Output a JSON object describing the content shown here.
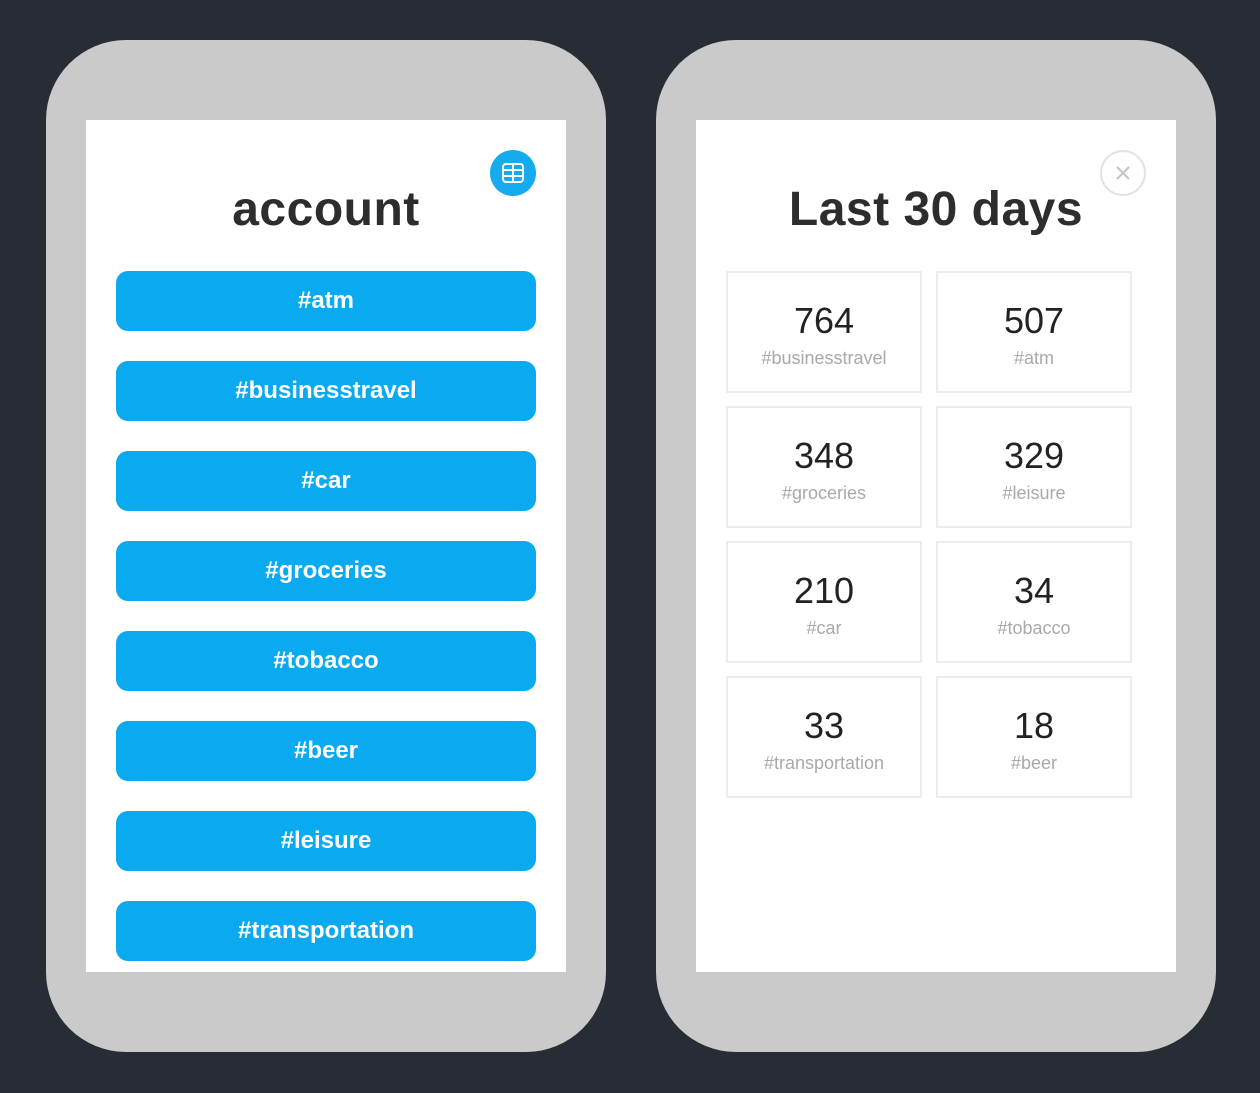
{
  "account_screen": {
    "title": "account",
    "menu_icon": "grid-menu-icon",
    "tags": [
      "#atm",
      "#businesstravel",
      "#car",
      "#groceries",
      "#tobacco",
      "#beer",
      "#leisure",
      "#transportation"
    ]
  },
  "stats_screen": {
    "title": "Last 30 days",
    "close_icon": "close-icon",
    "stats": [
      {
        "value": "764",
        "tag": "#businesstravel"
      },
      {
        "value": "507",
        "tag": "#atm"
      },
      {
        "value": "348",
        "tag": "#groceries"
      },
      {
        "value": "329",
        "tag": "#leisure"
      },
      {
        "value": "210",
        "tag": "#car"
      },
      {
        "value": "34",
        "tag": "#tobacco"
      },
      {
        "value": "33",
        "tag": "#transportation"
      },
      {
        "value": "18",
        "tag": "#beer"
      }
    ]
  },
  "colors": {
    "background": "#282c35",
    "phone_frame": "#cacaca",
    "accent": "#0aaaf0"
  }
}
